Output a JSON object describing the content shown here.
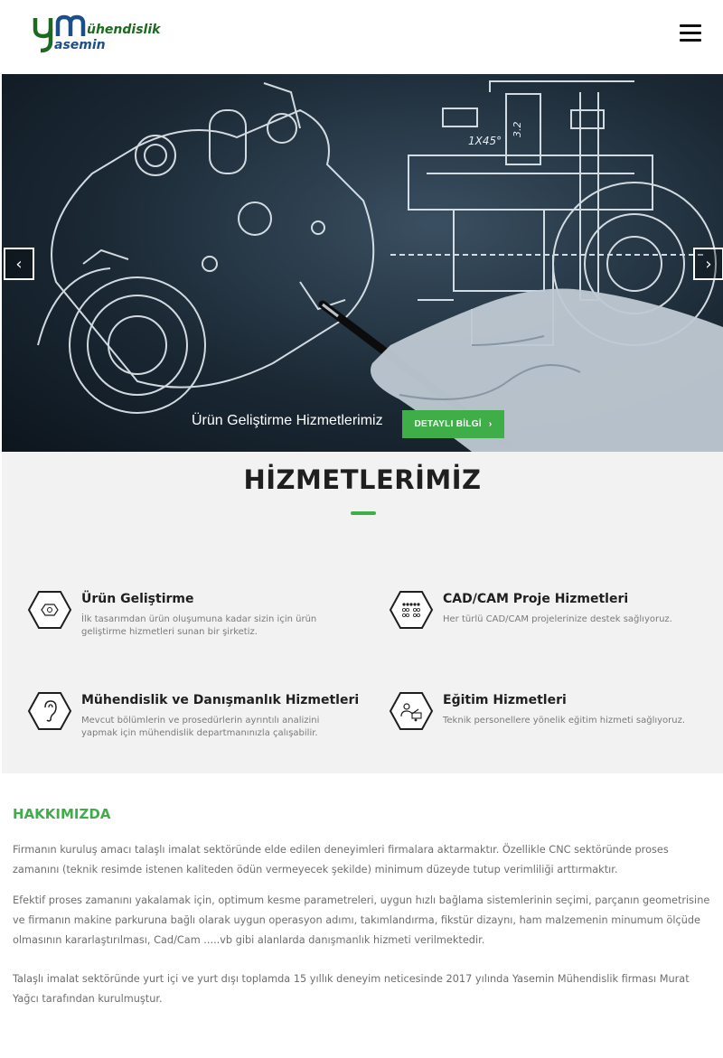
{
  "header": {
    "logo_mark": "ym",
    "logo_text_top": "ühendislik",
    "logo_text_bottom": "asemin",
    "menu_icon": "hamburger-icon"
  },
  "hero": {
    "caption": "Ürün Geliştirme Hizmetlerimiz",
    "button_label": "DETAYLI BİLGİ",
    "prev_arrow": "‹",
    "next_arrow": "›",
    "dimension_label_1": "1X45°",
    "dimension_label_2": "3.2"
  },
  "services": {
    "title": "HİZMETLERİMİZ",
    "items": [
      {
        "title": "Ürün Geliştirme",
        "description": "İlk tasarımdan ürün oluşumuna kadar sizin için ürün geliştirme hizmetleri sunan bir şirketiz.",
        "icon": "product-icon"
      },
      {
        "title": "CAD/CAM Proje Hizmetleri",
        "description": "Her türlü CAD/CAM projelerinize destek sağlıyoruz.",
        "icon": "dots-grid-icon"
      },
      {
        "title": "Mühendislik ve Danışmanlık Hizmetleri",
        "description": "Mevcut bölümlerin ve prosedürlerin ayrıntılı analizini yapmak için mühendislik departmanınızla çalışabilir.",
        "icon": "ear-icon"
      },
      {
        "title": "Eğitim Hizmetleri",
        "description": "Teknik personellere yönelik eğitim hizmeti sağlıyoruz.",
        "icon": "training-icon"
      }
    ]
  },
  "about": {
    "title": "HAKKIMIZDA",
    "paragraphs": [
      "Firmanın kuruluş amacı talaşlı imalat sektöründe elde edilen deneyimleri firmalara aktarmaktır. Özellikle CNC sektöründe proses zamanını (teknik resimde istenen kaliteden ödün vermeyecek şekilde) minimum düzeyde tutup verimliliği arttırmaktır.",
      "Efektif proses zamanını yakalamak için, optimum kesme parametreleri, uygun hızlı bağlama sistemlerinin seçimi, parçanın geometrisine ve firmanın makine parkuruna bağlı olarak uygun operasyon adımı, takımlandırma, fikstür dizaynı, ham malzemenin minumum ölçüde olmasının kararlaştırılması, Cad/Cam .....vb gibi alanlarda danışmanlık hizmeti verilmektedir.",
      "Talaşlı imalat sektöründe yurt içi ve yurt dışı toplamda 15 yıllık deneyim neticesinde 2017 yılında Yasemin Mühendislik firması Murat Yağcı tarafından kurulmuştur."
    ]
  },
  "colors": {
    "accent_green": "#3fae49",
    "logo_green": "#1b6a1e",
    "logo_blue": "#1b4f8a",
    "section_bg": "#f2f2f2"
  }
}
